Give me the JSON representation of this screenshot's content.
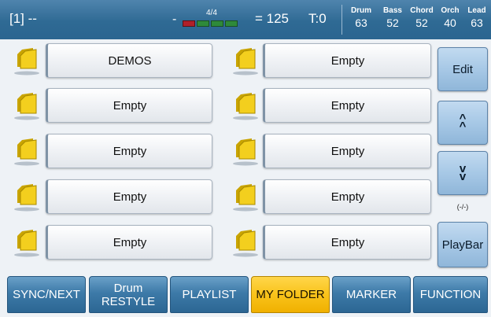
{
  "header": {
    "song_label": "[1] --",
    "dash": "-",
    "time_signature": "4/4",
    "beat_count": 4,
    "tempo": "= 125",
    "transpose": "T:0",
    "parts": [
      {
        "name": "Drum",
        "value": "63"
      },
      {
        "name": "Bass",
        "value": "52"
      },
      {
        "name": "Chord",
        "value": "52"
      },
      {
        "name": "Orch",
        "value": "40"
      },
      {
        "name": "Lead",
        "value": "63"
      }
    ]
  },
  "folders": {
    "left": [
      "DEMOS",
      "Empty",
      "Empty",
      "Empty",
      "Empty"
    ],
    "right": [
      "Empty",
      "Empty",
      "Empty",
      "Empty",
      "Empty"
    ]
  },
  "side": {
    "edit": "Edit",
    "page_indicator": "(-/-)",
    "playbar": "PlayBar"
  },
  "tabs": [
    {
      "line1": "",
      "line2": "SYNC/NEXT",
      "active": false
    },
    {
      "line1": "Drum",
      "line2": "RESTYLE",
      "active": false
    },
    {
      "line1": "",
      "line2": "PLAYLIST",
      "active": false
    },
    {
      "line1": "",
      "line2": "MY FOLDER",
      "active": true
    },
    {
      "line1": "",
      "line2": "MARKER",
      "active": false
    },
    {
      "line1": "",
      "line2": "FUNCTION",
      "active": false
    }
  ],
  "colors": {
    "header": "#2f6a94",
    "tab_active": "#f9c31b",
    "side_button": "#a7c8e6",
    "folder_icon": "#f3cf1e"
  },
  "icons": {
    "folder": "folder-icon",
    "scroll_up": "chevron-up-icon",
    "scroll_down": "chevron-down-icon"
  }
}
